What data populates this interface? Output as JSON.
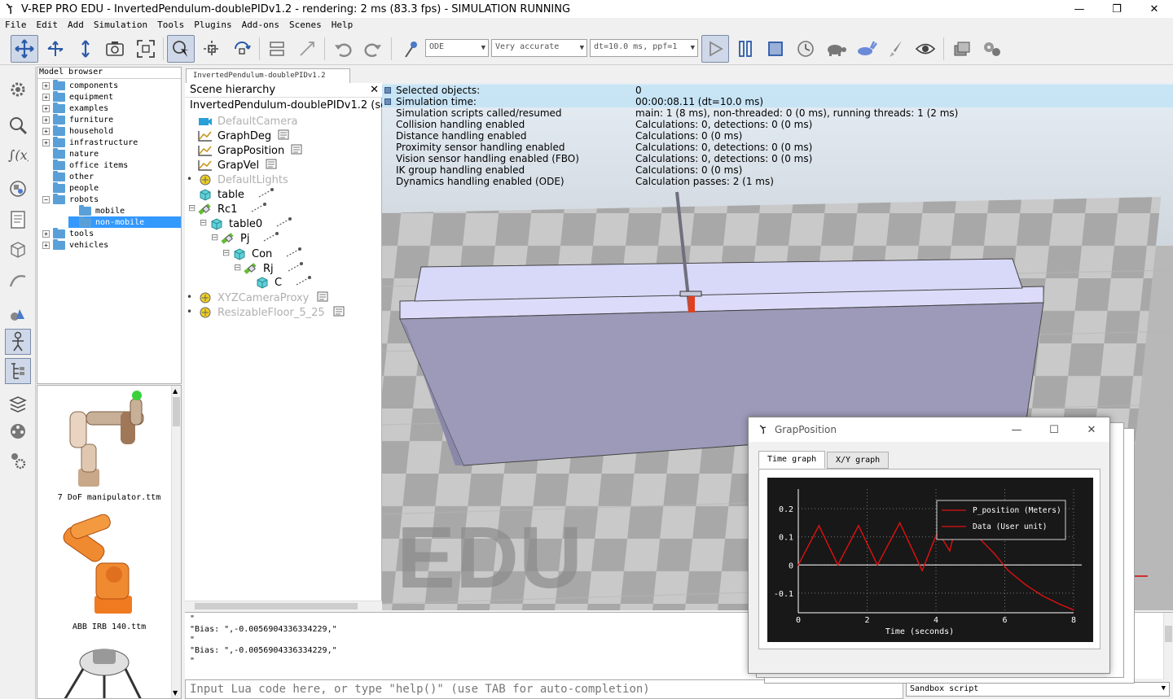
{
  "window": {
    "title": "V-REP PRO EDU - InvertedPendulum-doublePIDv1.2 - rendering: 2 ms (83.3 fps) - SIMULATION RUNNING",
    "minimize": "—",
    "maximize": "❐",
    "close": "✕"
  },
  "menu": [
    "File",
    "Edit",
    "Add",
    "Simulation",
    "Tools",
    "Plugins",
    "Add-ons",
    "Scenes",
    "Help"
  ],
  "toolbar": {
    "engine": "ODE",
    "accuracy": "Very accurate",
    "timestep": "dt=10.0 ms, ppf=1"
  },
  "model_browser": {
    "header": "Model browser",
    "items": [
      {
        "label": "components",
        "expander": "+"
      },
      {
        "label": "equipment",
        "expander": "+"
      },
      {
        "label": "examples",
        "expander": "+"
      },
      {
        "label": "furniture",
        "expander": "+"
      },
      {
        "label": "household",
        "expander": "+"
      },
      {
        "label": "infrastructure",
        "expander": "+"
      },
      {
        "label": "nature",
        "expander": ""
      },
      {
        "label": "office items",
        "expander": ""
      },
      {
        "label": "other",
        "expander": ""
      },
      {
        "label": "people",
        "expander": ""
      },
      {
        "label": "robots",
        "expander": "−"
      },
      {
        "label": "mobile",
        "expander": ""
      },
      {
        "label": "non-mobile",
        "expander": ""
      },
      {
        "label": "tools",
        "expander": "+"
      },
      {
        "label": "vehicles",
        "expander": "+"
      }
    ],
    "thumbs": [
      "7 DoF manipulator.ttm",
      "ABB IRB 140.ttm"
    ]
  },
  "doc_tab": "InvertedPendulum-doublePIDv1.2",
  "scene_hierarchy": {
    "header": "Scene hierarchy",
    "close": "✕",
    "scene_name": "InvertedPendulum-doublePIDv1.2 (scen",
    "items": [
      {
        "label": "DefaultCamera",
        "icon": "camera-icon",
        "dim": true
      },
      {
        "label": "GraphDeg",
        "icon": "graph-icon",
        "dim": false
      },
      {
        "label": "GrapPosition",
        "icon": "graph-icon",
        "dim": false
      },
      {
        "label": "GrapVel",
        "icon": "graph-icon",
        "dim": false
      },
      {
        "label": "DefaultLights",
        "icon": "light-icon",
        "dim": true
      },
      {
        "label": "table",
        "icon": "shape-icon",
        "dim": false
      },
      {
        "label": "Rc1",
        "icon": "joint-icon",
        "dim": false
      },
      {
        "label": "table0",
        "icon": "shape-icon",
        "dim": false
      },
      {
        "label": "Pj",
        "icon": "joint-icon",
        "dim": false
      },
      {
        "label": "Con",
        "icon": "shape-icon",
        "dim": false
      },
      {
        "label": "Rj",
        "icon": "joint-icon",
        "dim": false
      },
      {
        "label": "C",
        "icon": "shape-icon",
        "dim": false
      },
      {
        "label": "XYZCameraProxy",
        "icon": "light-icon",
        "dim": true
      },
      {
        "label": "ResizableFloor_5_25",
        "icon": "light-icon",
        "dim": true
      }
    ]
  },
  "info": [
    {
      "label": "Selected objects:",
      "value": "0"
    },
    {
      "label": "Simulation time:",
      "value": "00:00:08.11 (dt=10.0 ms)"
    },
    {
      "label": "Simulation scripts called/resumed",
      "value": "main: 1 (8 ms), non-threaded: 0 (0 ms), running threads: 1 (2 ms)"
    },
    {
      "label": "Collision handling enabled",
      "value": "Calculations: 0, detections: 0 (0 ms)"
    },
    {
      "label": "Distance handling enabled",
      "value": "Calculations: 0 (0 ms)"
    },
    {
      "label": "Proximity sensor handling enabled",
      "value": "Calculations: 0, detections: 0 (0 ms)"
    },
    {
      "label": "Vision sensor handling enabled (FBO)",
      "value": "Calculations: 0, detections: 0 (0 ms)"
    },
    {
      "label": "IK group handling enabled",
      "value": "Calculations: 0 (0 ms)"
    },
    {
      "label": "Dynamics handling enabled (ODE)",
      "value": "Calculation passes: 2 (1 ms)"
    }
  ],
  "watermark": "EDU",
  "console": {
    "lines": [
      "\"",
      "\"Bias: \",-0.0056904336334229,\"",
      "\"",
      "\"Bias: \",-0.0056904336334229,\"",
      "\""
    ],
    "input_placeholder": "Input Lua code here, or type \"help()\" (use TAB for auto-completion)",
    "sandbox": "Sandbox script"
  },
  "graph_window": {
    "title": "GrapPosition",
    "tabs": [
      "Time graph",
      "X/Y graph"
    ],
    "legend": [
      "P_position (Meters)",
      "Data (User unit)"
    ],
    "xlabel": "Time (seconds)",
    "colors": {
      "series": "#e01010",
      "axis": "#ffffff",
      "background": "#181818"
    }
  },
  "chart_data": {
    "type": "line",
    "title": "",
    "xlabel": "Time (seconds)",
    "ylabel": "",
    "xlim": [
      0,
      8
    ],
    "ylim": [
      -0.17,
      0.27
    ],
    "xticks": [
      0,
      2,
      4,
      6,
      8
    ],
    "yticks": [
      -0.1,
      0,
      0.1,
      0.2
    ],
    "ytick_labels": [
      "-0.1",
      "0",
      "0.1",
      "0.2"
    ],
    "grid": true,
    "legend_position": "top-right",
    "series": [
      {
        "name": "P_position (Meters)",
        "x": [
          0,
          0.6,
          1.15,
          1.75,
          2.3,
          2.95,
          3.6,
          4.05,
          4.4,
          4.75,
          5.0,
          5.3,
          5.7,
          6.1,
          6.6,
          7.1,
          7.6,
          8.0
        ],
        "y": [
          0,
          0.14,
          0,
          0.14,
          0,
          0.15,
          -0.02,
          0.12,
          0.05,
          0.22,
          0.2,
          0.09,
          0.04,
          -0.02,
          -0.07,
          -0.11,
          -0.14,
          -0.16
        ]
      }
    ]
  }
}
